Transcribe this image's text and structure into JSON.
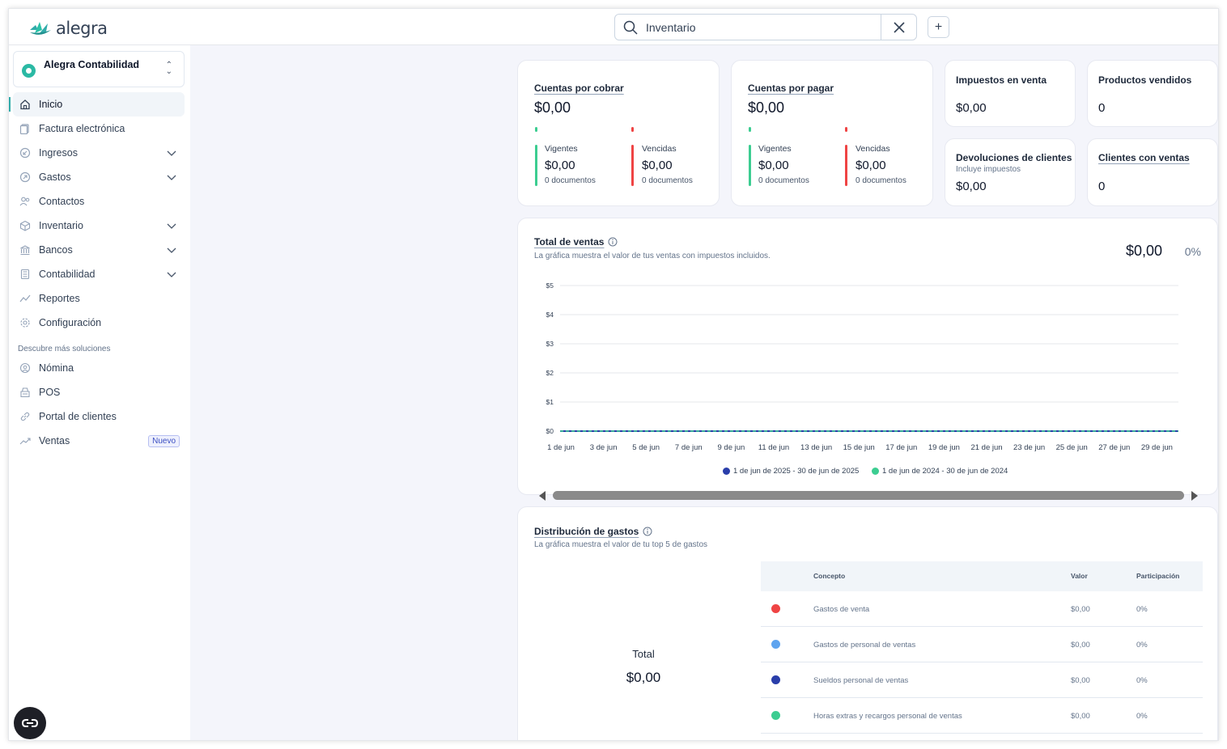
{
  "brand": {
    "name": "alegra",
    "accent": "#30aba9"
  },
  "search": {
    "value": "Inventario",
    "icon": "search-icon",
    "clear_icon": "close-icon"
  },
  "topbar": {
    "add_label": "+"
  },
  "company": {
    "name": "Alegra Contabilidad"
  },
  "nav": {
    "items": [
      {
        "label": "Inicio",
        "icon": "home-icon"
      },
      {
        "label": "Factura electrónica",
        "icon": "document-icon"
      },
      {
        "label": "Ingresos",
        "icon": "income-icon"
      },
      {
        "label": "Gastos",
        "icon": "expense-icon"
      },
      {
        "label": "Contactos",
        "icon": "contacts-icon"
      },
      {
        "label": "Inventario",
        "icon": "box-icon"
      },
      {
        "label": "Bancos",
        "icon": "bank-icon"
      },
      {
        "label": "Contabilidad",
        "icon": "calculator-icon"
      },
      {
        "label": "Reportes",
        "icon": "chart-line-icon"
      },
      {
        "label": "Configuración",
        "icon": "gear-icon"
      }
    ],
    "section_label": "Descubre más soluciones",
    "extra_items": [
      {
        "label": "Nómina",
        "icon": "payroll-icon"
      },
      {
        "label": "POS",
        "icon": "pos-icon"
      },
      {
        "label": "Portal de clientes",
        "icon": "link-icon"
      },
      {
        "label": "Ventas",
        "icon": "trend-icon",
        "badge": "Nuevo"
      }
    ]
  },
  "summary": {
    "receivable": {
      "title": "Cuentas por cobrar",
      "value": "$0,00",
      "current_label": "Vigentes",
      "current_value": "$0,00",
      "current_docs": "0 documentos",
      "overdue_label": "Vencidas",
      "overdue_value": "$0,00",
      "overdue_docs": "0 documentos"
    },
    "payable": {
      "title": "Cuentas por pagar",
      "value": "$0,00",
      "current_label": "Vigentes",
      "current_value": "$0,00",
      "current_docs": "0 documentos",
      "overdue_label": "Vencidas",
      "overdue_value": "$0,00",
      "overdue_docs": "0 documentos"
    },
    "sales_tax": {
      "title": "Impuestos en venta",
      "value": "$0,00"
    },
    "products_sold": {
      "title": "Productos vendidos",
      "value": "0"
    },
    "client_returns": {
      "title": "Devoluciones de clientes",
      "subtitle": "Incluye impuestos",
      "value": "$0,00"
    },
    "clients_with_sales": {
      "title": "Clientes con ventas",
      "value": "0"
    }
  },
  "sales": {
    "title": "Total de ventas",
    "description": "La gráfica muestra el valor de tus ventas con impuestos incluidos.",
    "total": "$0,00",
    "change": "0%"
  },
  "chart_data": {
    "type": "line",
    "x": [
      "1 de jun",
      "3 de jun",
      "5 de jun",
      "7 de jun",
      "9 de jun",
      "11 de jun",
      "13 de jun",
      "15 de jun",
      "17 de jun",
      "19 de jun",
      "21 de jun",
      "23 de jun",
      "25 de jun",
      "27 de jun",
      "29 de jun"
    ],
    "y_ticks": [
      "$0",
      "$1",
      "$2",
      "$3",
      "$4",
      "$5"
    ],
    "ylim": [
      0,
      5
    ],
    "grid": true,
    "legend_position": "bottom",
    "series": [
      {
        "name": "1 de jun de 2025 - 30 de jun de 2025",
        "color": "#2a3eaa",
        "values": [
          0,
          0,
          0,
          0,
          0,
          0,
          0,
          0,
          0,
          0,
          0,
          0,
          0,
          0,
          0
        ]
      },
      {
        "name": "1 de jun de 2024 - 30 de jun de 2024",
        "color": "#3ccd91",
        "values": [
          0,
          0,
          0,
          0,
          0,
          0,
          0,
          0,
          0,
          0,
          0,
          0,
          0,
          0,
          0
        ]
      }
    ]
  },
  "expenses": {
    "title": "Distribución de gastos",
    "description": "La gráfica muestra el valor de tu top 5 de gastos",
    "total_label": "Total",
    "total_value": "$0,00",
    "columns": [
      "Concepto",
      "Valor",
      "Participación"
    ],
    "rows": [
      {
        "concept": "Gastos de venta",
        "value": "$0,00",
        "share": "0%",
        "color": "#ef4444"
      },
      {
        "concept": "Gastos de personal de ventas",
        "value": "$0,00",
        "share": "0%",
        "color": "#5ea4ef"
      },
      {
        "concept": "Sueldos personal de ventas",
        "value": "$0,00",
        "share": "0%",
        "color": "#2a3eaa"
      },
      {
        "concept": "Horas extras y recargos personal de ventas",
        "value": "$0,00",
        "share": "0%",
        "color": "#3ccd91"
      }
    ]
  }
}
